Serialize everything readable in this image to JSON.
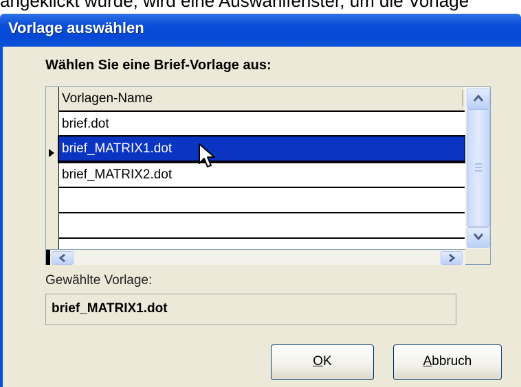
{
  "caption_fragment": "angeklickt wurde, wird eine Auswahlfenster, um die Vorlage",
  "dialog": {
    "title": "Vorlage auswählen",
    "prompt": "Wählen Sie eine Brief-Vorlage aus:",
    "grid": {
      "column_header": "Vorlagen-Name",
      "rows": [
        "brief.dot",
        "brief_MATRIX1.dot",
        "brief_MATRIX2.dot",
        "",
        ""
      ],
      "selected_index": 1
    },
    "selected_label": "Gewählte Vorlage:",
    "selected_value": "brief_MATRIX1.dot",
    "ok_button": {
      "mnemonic": "O",
      "rest": "K"
    },
    "cancel_button": {
      "mnemonic": "A",
      "rest": "bbruch"
    }
  },
  "colors": {
    "titlebar": "#0a4fd9",
    "selection": "#0a35c2",
    "dialog_face": "#ece9d8"
  },
  "icons": [
    "scroll-up-icon",
    "scroll-down-icon",
    "scroll-left-icon",
    "scroll-right-icon",
    "row-pointer-icon",
    "mouse-cursor-icon"
  ]
}
